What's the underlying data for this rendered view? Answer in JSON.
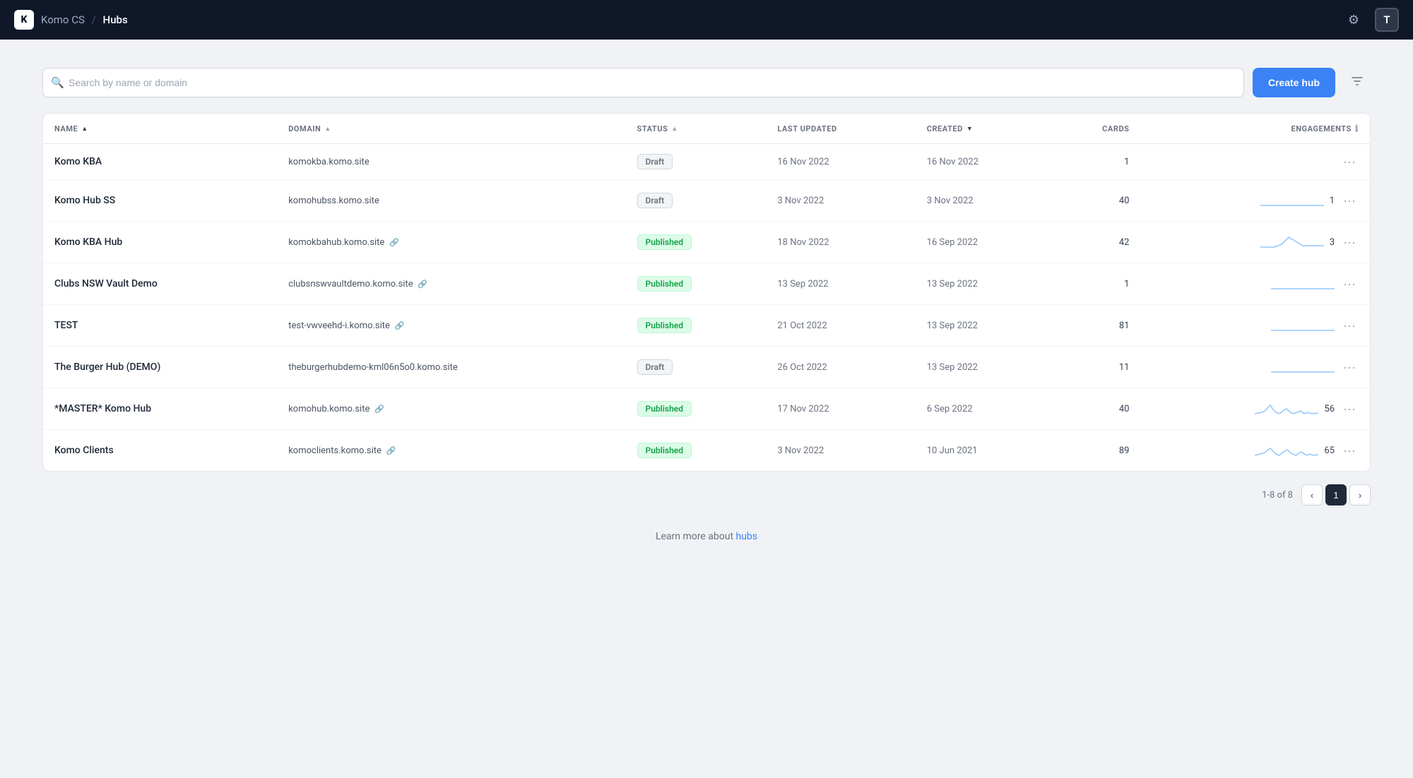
{
  "nav": {
    "logo": "K",
    "org": "Komo CS",
    "separator": "/",
    "page": "Hubs",
    "settings_icon": "⚙",
    "avatar": "T"
  },
  "toolbar": {
    "search_placeholder": "Search by name or domain",
    "create_label": "Create hub",
    "filter_icon": "▽"
  },
  "table": {
    "columns": [
      {
        "key": "name",
        "label": "NAME",
        "sortable": true
      },
      {
        "key": "domain",
        "label": "DOMAIN",
        "sortable": true
      },
      {
        "key": "status",
        "label": "STATUS",
        "sortable": true
      },
      {
        "key": "last_updated",
        "label": "LAST UPDATED",
        "sortable": false
      },
      {
        "key": "created",
        "label": "CREATED",
        "sortable": true
      },
      {
        "key": "cards",
        "label": "CARDS",
        "sortable": false
      },
      {
        "key": "engagements",
        "label": "ENGAGEMENTS",
        "sortable": false
      }
    ],
    "rows": [
      {
        "name": "Komo KBA",
        "domain": "komokba.komo.site",
        "has_link": false,
        "status": "Draft",
        "last_updated": "16 Nov 2022",
        "created": "16 Nov 2022",
        "cards": 1,
        "engagements": null,
        "sparkline": []
      },
      {
        "name": "Komo Hub SS",
        "domain": "komohubss.komo.site",
        "has_link": false,
        "status": "Draft",
        "last_updated": "3 Nov 2022",
        "created": "3 Nov 2022",
        "cards": 40,
        "engagements": 1,
        "sparkline": "flat"
      },
      {
        "name": "Komo KBA Hub",
        "domain": "komokbahub.komo.site",
        "has_link": true,
        "status": "Published",
        "last_updated": "18 Nov 2022",
        "created": "16 Sep 2022",
        "cards": 42,
        "engagements": 3,
        "sparkline": "spike"
      },
      {
        "name": "Clubs NSW Vault Demo",
        "domain": "clubsnswvaultdemo.komo.site",
        "has_link": true,
        "status": "Published",
        "last_updated": "13 Sep 2022",
        "created": "13 Sep 2022",
        "cards": 1,
        "engagements": null,
        "sparkline": "flat"
      },
      {
        "name": "TEST",
        "domain": "test-vwveehd-i.komo.site",
        "has_link": true,
        "status": "Published",
        "last_updated": "21 Oct 2022",
        "created": "13 Sep 2022",
        "cards": 81,
        "engagements": null,
        "sparkline": "flat"
      },
      {
        "name": "The Burger Hub (DEMO)",
        "domain": "theburgerhubdemo-kml06n5o0.komo.site",
        "has_link": false,
        "status": "Draft",
        "last_updated": "26 Oct 2022",
        "created": "13 Sep 2022",
        "cards": 11,
        "engagements": null,
        "sparkline": "flat"
      },
      {
        "name": "*MASTER* Komo Hub",
        "domain": "komohub.komo.site",
        "has_link": true,
        "status": "Published",
        "last_updated": "17 Nov 2022",
        "created": "6 Sep 2022",
        "cards": 40,
        "engagements": 56,
        "sparkline": "wavy"
      },
      {
        "name": "Komo Clients",
        "domain": "komoclients.komo.site",
        "has_link": true,
        "status": "Published",
        "last_updated": "3 Nov 2022",
        "created": "10 Jun 2021",
        "cards": 89,
        "engagements": 65,
        "sparkline": "wavy2"
      }
    ]
  },
  "pagination": {
    "info": "1-8 of 8",
    "current_page": 1,
    "prev_label": "‹",
    "next_label": "›"
  },
  "footer": {
    "text": "Learn more about ",
    "link_label": "hubs",
    "link_href": "#"
  }
}
